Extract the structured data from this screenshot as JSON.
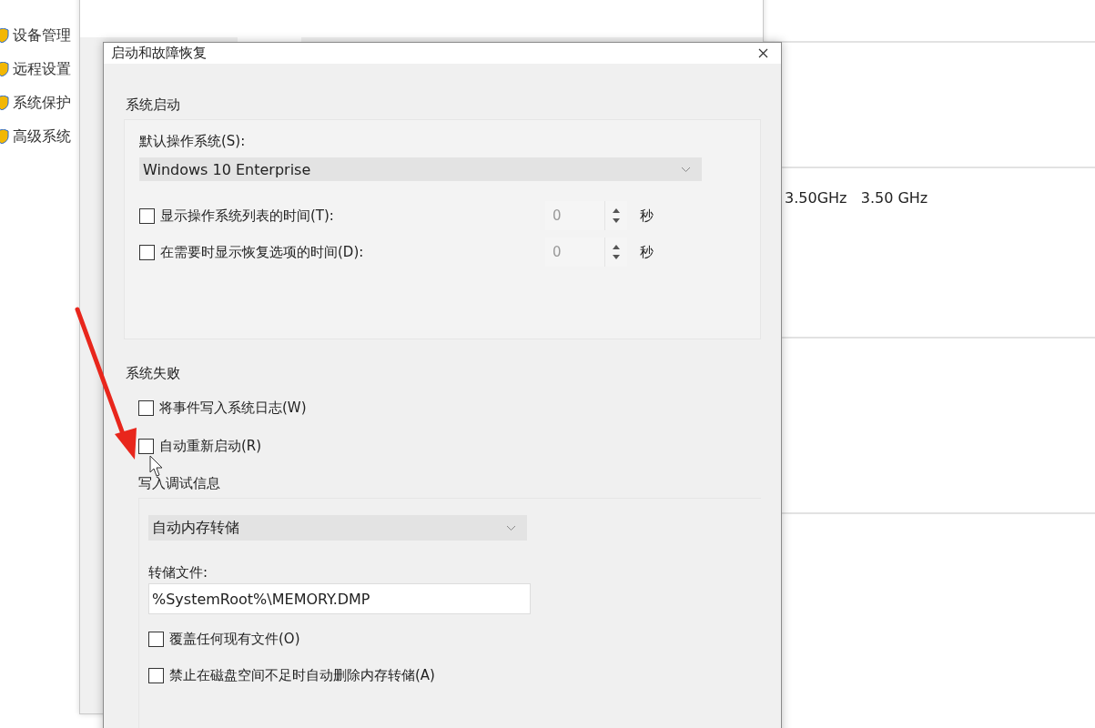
{
  "background_window": {
    "sidebar_items": [
      "设备管理",
      "远程设置",
      "系统保护",
      "高级系统"
    ],
    "processor_speed": "3.50GHz   3.50 GHz"
  },
  "dialog": {
    "title": "启动和故障恢复",
    "system_startup": {
      "title": "系统启动",
      "default_os_label": "默认操作系统(S):",
      "default_os": "Windows 10 Enterprise",
      "options": [
        {
          "label": "显示操作系统列表的时间(T):",
          "checked": false,
          "value": "0",
          "unit": "秒"
        },
        {
          "label": "在需要时显示恢复选项的时间(D):",
          "checked": false,
          "value": "0",
          "unit": "秒"
        }
      ]
    },
    "system_failure": {
      "title": "系统失败",
      "options": [
        {
          "label": "将事件写入系统日志(W)",
          "checked": false
        },
        {
          "label": "自动重新启动(R)",
          "checked": false
        }
      ],
      "debug_info": {
        "title": "写入调试信息",
        "type": "自动内存转储",
        "dump_file_label": "转储文件:",
        "dump_file": "%SystemRoot%\\MEMORY.DMP",
        "options": [
          {
            "label": "覆盖任何现有文件(O)",
            "checked": false
          },
          {
            "label": "禁止在磁盘空间不足时自动删除内存转储(A)",
            "checked": false
          }
        ]
      }
    }
  }
}
